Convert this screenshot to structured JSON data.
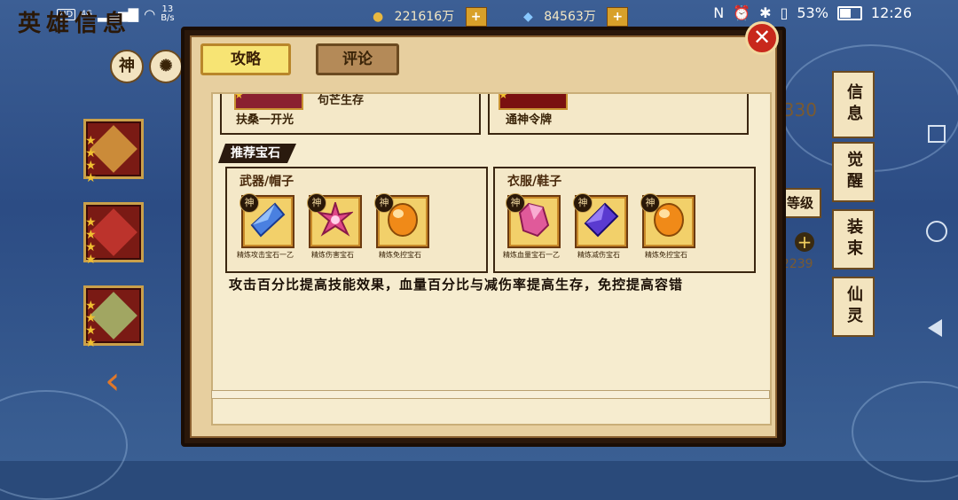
{
  "status_bar": {
    "hd": "HD",
    "network": "4G",
    "speed_top": "13",
    "speed_bottom": "B/s",
    "battery": "53%",
    "time": "12:26"
  },
  "top_bar": {
    "coins": "221616万",
    "diamonds": "84563万",
    "other": "1"
  },
  "game": {
    "title": "英雄信息",
    "attr_button": "神",
    "level_button": "等级",
    "fragment_count": "/330",
    "fragment_power": "32239"
  },
  "side_tabs": [
    "信息",
    "觉醒",
    "装束",
    "仙灵"
  ],
  "dialog": {
    "tabs": [
      {
        "label": "攻略",
        "active": true
      },
      {
        "label": "评论",
        "active": false
      }
    ],
    "close_label": "✕",
    "top_items": [
      {
        "name": "扶桑一开光",
        "subtitle": "句芒生存"
      },
      {
        "name": "通神令牌"
      }
    ],
    "section_title": "推荐宝石",
    "gem_groups": [
      {
        "title": "武器/帽子",
        "gems": [
          {
            "badge": "神",
            "name": "精炼攻击宝石一乙",
            "color": "#4a80e0"
          },
          {
            "badge": "神",
            "name": "精炼伤害宝石",
            "color": "#e04888"
          },
          {
            "badge": "神",
            "name": "精炼免控宝石",
            "color": "#f08a18"
          }
        ]
      },
      {
        "title": "衣服/鞋子",
        "gems": [
          {
            "badge": "神",
            "name": "精炼血量宝石一乙",
            "color": "#e05a9a"
          },
          {
            "badge": "神",
            "name": "精炼减伤宝石",
            "color": "#5a3ad0"
          },
          {
            "badge": "神",
            "name": "精炼免控宝石",
            "color": "#f08a18"
          }
        ]
      }
    ],
    "description": "攻击百分比提高技能效果，血量百分比与减伤率提高生存，免控提高容错"
  }
}
